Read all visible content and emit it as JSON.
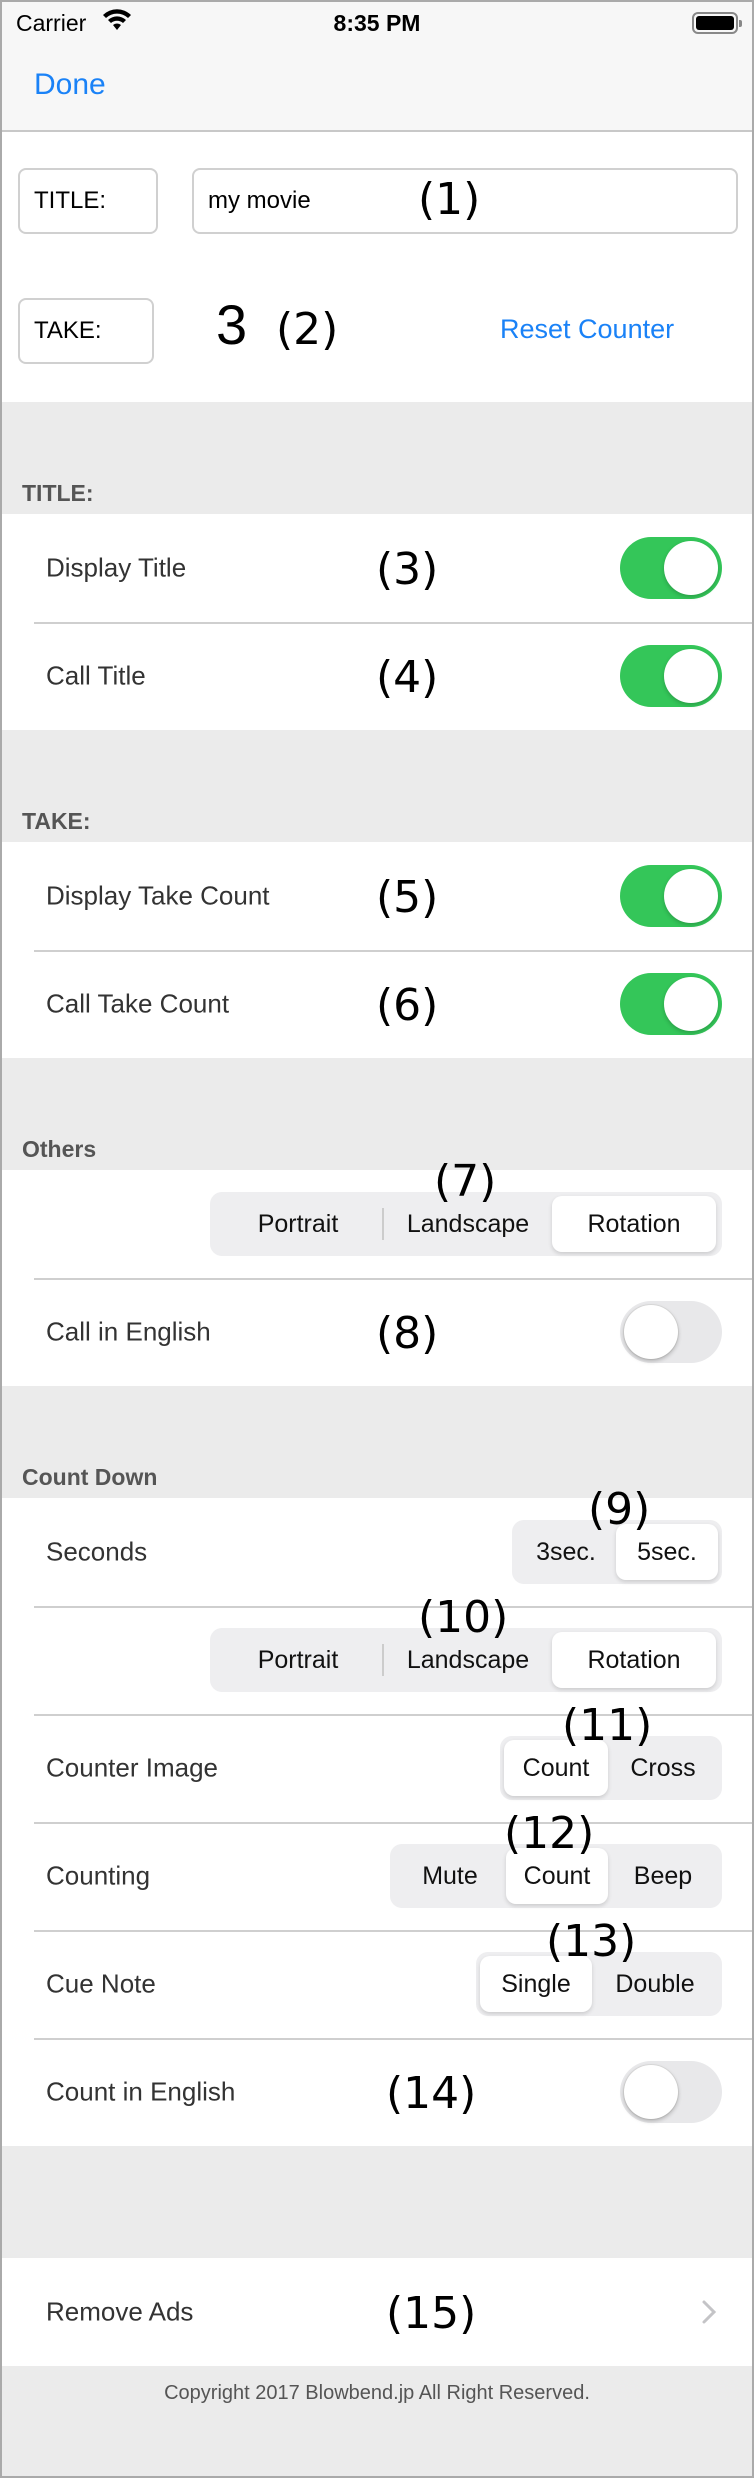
{
  "status_bar": {
    "carrier": "Carrier",
    "time": "8:35 PM",
    "wifi_icon": "wifi-icon",
    "battery_icon": "battery-icon"
  },
  "nav": {
    "done_label": "Done"
  },
  "top": {
    "title_label": "TITLE:",
    "title_value": "my movie",
    "title_annotation": "(1)",
    "take_label": "TAKE:",
    "take_value": "3",
    "take_annotation": "(2)",
    "reset_label": "Reset Counter"
  },
  "sections": {
    "title": {
      "header": "TITLE:",
      "rows": [
        {
          "label": "Display Title",
          "annotation": "(3)",
          "on": true
        },
        {
          "label": "Call Title",
          "annotation": "(4)",
          "on": true
        }
      ]
    },
    "take": {
      "header": "TAKE:",
      "rows": [
        {
          "label": "Display Take Count",
          "annotation": "(5)",
          "on": true
        },
        {
          "label": "Call Take Count",
          "annotation": "(6)",
          "on": true
        }
      ]
    },
    "others": {
      "header": "Others",
      "orientation": {
        "annotation": "(7)",
        "options": [
          "Portrait",
          "Landscape",
          "Rotation"
        ],
        "selected": "Rotation"
      },
      "call_english": {
        "label": "Call in English",
        "annotation": "(8)",
        "on": false
      }
    },
    "countdown": {
      "header": "Count Down",
      "seconds": {
        "label": "Seconds",
        "annotation": "(9)",
        "options": [
          "3sec.",
          "5sec."
        ],
        "selected": "5sec."
      },
      "orientation": {
        "annotation": "(10)",
        "options": [
          "Portrait",
          "Landscape",
          "Rotation"
        ],
        "selected": "Rotation"
      },
      "counter_image": {
        "label": "Counter Image",
        "annotation": "(11)",
        "options": [
          "Count",
          "Cross"
        ],
        "selected": "Count"
      },
      "counting": {
        "label": "Counting",
        "annotation": "(12)",
        "options": [
          "Mute",
          "Count",
          "Beep"
        ],
        "selected": "Count"
      },
      "cue_note": {
        "label": "Cue Note",
        "annotation": "(13)",
        "options": [
          "Single",
          "Double"
        ],
        "selected": "Single"
      },
      "count_english": {
        "label": "Count in English",
        "annotation": "(14)",
        "on": false
      }
    },
    "ads": {
      "label": "Remove Ads",
      "annotation": "(15)",
      "chevron_icon": "chevron-right-icon"
    }
  },
  "footer": {
    "copyright": "Copyright 2017 Blowbend.jp All Right Reserved."
  },
  "colors": {
    "accent": "#1a82f7",
    "toggle_on": "#34c659",
    "toggle_off": "#e8e8ea",
    "background": "#ebebeb"
  }
}
